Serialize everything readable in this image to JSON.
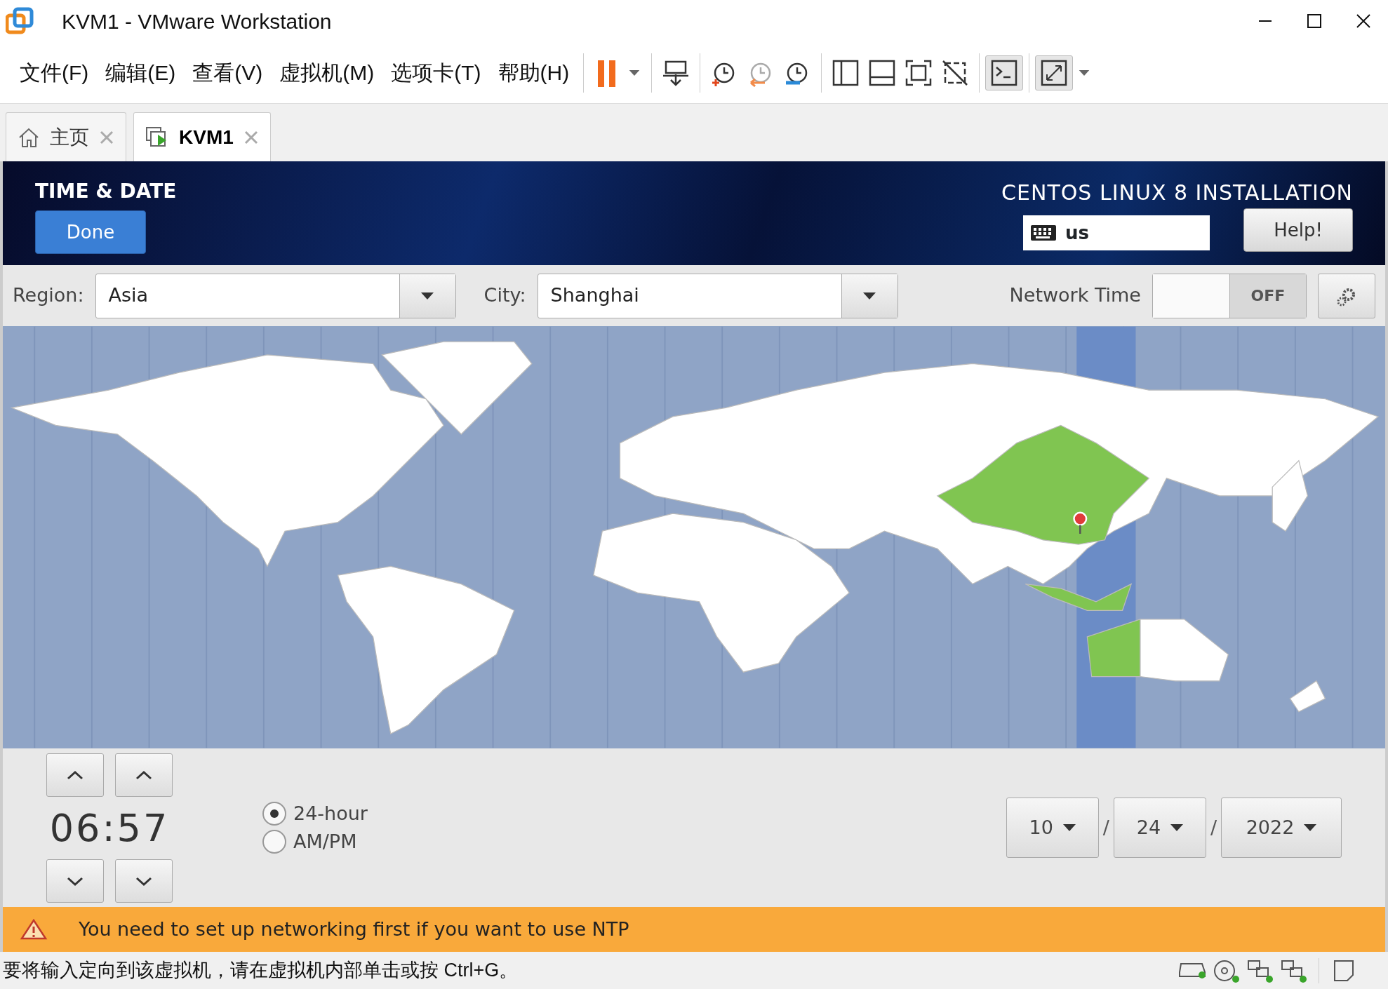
{
  "window": {
    "title": "KVM1 - VMware Workstation"
  },
  "menu": [
    "文件(F)",
    "编辑(E)",
    "查看(V)",
    "虚拟机(M)",
    "选项卡(T)",
    "帮助(H)"
  ],
  "tabs": [
    {
      "label": "主页",
      "kind": "home",
      "selected": false
    },
    {
      "label": "KVM1",
      "kind": "vm",
      "selected": true
    }
  ],
  "installer": {
    "title": "TIME & DATE",
    "done_button": "Done",
    "product": "CENTOS LINUX 8 INSTALLATION",
    "keyboard_layout": "us",
    "help_button": "Help!",
    "region": {
      "label": "Region:",
      "value": "Asia"
    },
    "city": {
      "label": "City:",
      "value": "Shanghai"
    },
    "network_time": {
      "label": "Network Time",
      "state_text": "OFF",
      "on": false
    },
    "time": "06:57",
    "time_formats": [
      {
        "label": "24-hour",
        "selected": true
      },
      {
        "label": "AM/PM",
        "selected": false
      }
    ],
    "date": {
      "month": "10",
      "day": "24",
      "year": "2022",
      "separators": [
        "/",
        "/"
      ]
    },
    "warning": "You need to set up networking first if you want to use NTP"
  },
  "status_bar": {
    "message": "要将输入定向到该虚拟机，请在虚拟机内部单击或按 Ctrl+G。"
  }
}
